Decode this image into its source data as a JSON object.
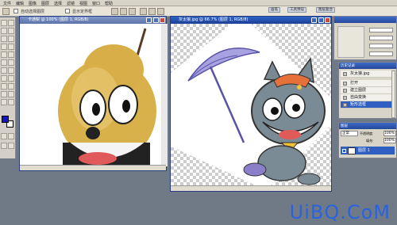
{
  "menu": {
    "items": [
      "文件",
      "编辑",
      "图像",
      "图层",
      "选择",
      "滤镜",
      "视图",
      "窗口",
      "帮助"
    ]
  },
  "options_bar": {
    "auto_select_layer": "自动选择图层",
    "show_bounding_box": "显示定界框"
  },
  "palette_tabs": [
    "画笔",
    "工具预设",
    "图层复合"
  ],
  "doc1": {
    "title": "卡通梨 @ 100% (图层 1, RGB/8)"
  },
  "doc2": {
    "title": "灰太狼.jpg @ 66.7% (图层 1, RGB/8)"
  },
  "history": {
    "title": "历史记录",
    "snapshot": "灰太狼.jpg",
    "items": [
      "打开",
      "建立图层",
      "自由变换",
      "矩形选框"
    ]
  },
  "layers": {
    "title": "图层",
    "blend_mode": "正常",
    "opacity_label": "不透明度:",
    "opacity": "100%",
    "fill_label": "填充:",
    "fill": "100%",
    "layer_name": "图层 1"
  },
  "watermark": "UiBQ.CoM",
  "colors": {
    "accent": "#2f5fc0",
    "foreground": "#1515c8",
    "background": "#ffffff"
  }
}
